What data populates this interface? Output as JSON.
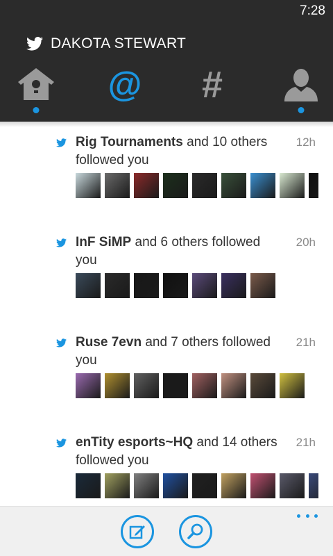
{
  "status_bar": {
    "time": "7:28"
  },
  "header": {
    "title": "DAKOTA STEWART"
  },
  "nav": {
    "tabs": [
      {
        "name": "home",
        "icon": "birdhouse-icon",
        "has_dot": true,
        "active": false
      },
      {
        "name": "mentions",
        "icon": "at-icon",
        "has_dot": false,
        "active": true
      },
      {
        "name": "discover",
        "icon": "hashtag-icon",
        "has_dot": false,
        "active": false
      },
      {
        "name": "me",
        "icon": "person-icon",
        "has_dot": true,
        "active": false
      }
    ]
  },
  "colors": {
    "accent": "#1b95e0",
    "header_bg": "#2b2b2b",
    "appbar_bg": "#f0f0f0"
  },
  "feed": {
    "items": [
      {
        "name": "Rig Tournaments",
        "rest": " and 10 others followed you",
        "time": "12h",
        "avatars": [
          "#c8d8dc",
          "#6a6a6a",
          "#8b2a2a",
          "#1c2f1c",
          "#2a2a2a",
          "#39503a",
          "#3a8fd0",
          "#d8e8d0",
          "#101010"
        ]
      },
      {
        "name": "InF SiMP",
        "rest": " and 6 others followed you",
        "time": "20h",
        "avatars": [
          "#3a4a5a",
          "#2a2a2a",
          "#181818",
          "#101010",
          "#5a4a7a",
          "#3a3060",
          "#7a5a4a"
        ]
      },
      {
        "name": "Ruse 7evn",
        "rest": " and 7 others followed you",
        "time": "21h",
        "avatars": [
          "#9a6ab0",
          "#b09030",
          "#606060",
          "#1a1a1a",
          "#a06060",
          "#c09080",
          "#5a4a3a",
          "#d0c040"
        ]
      },
      {
        "name": "enTity esports~HQ",
        "rest": " and 14 others followed you",
        "time": "21h",
        "avatars": [
          "#1a2a3a",
          "#a0a060",
          "#808080",
          "#2050a0",
          "#202020",
          "#c0a060",
          "#c05070",
          "#5a5a6a",
          "#3a4a7a"
        ]
      }
    ]
  },
  "appbar": {
    "buttons": [
      "compose-icon",
      "search-icon"
    ],
    "more": "more-icon"
  }
}
